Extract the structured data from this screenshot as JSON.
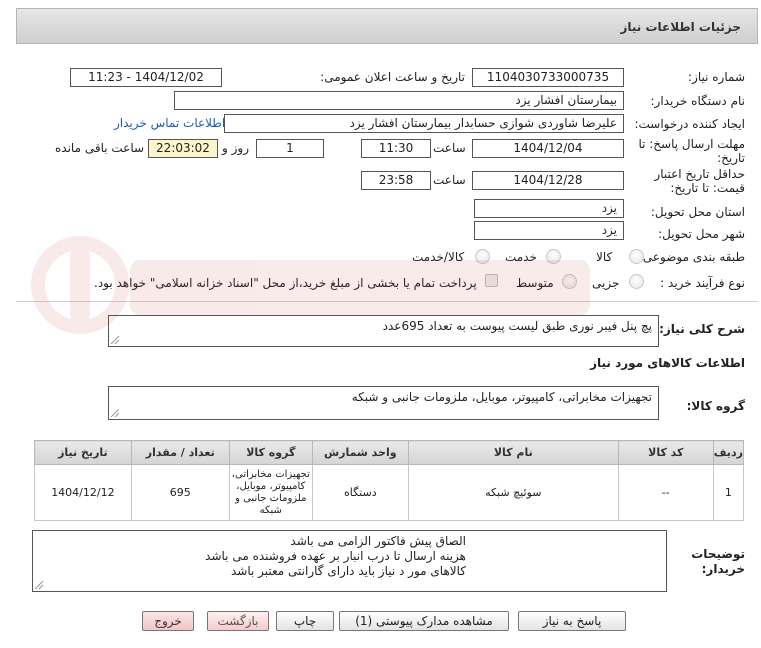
{
  "header": {
    "title": "جزئیات اطلاعات نیاز"
  },
  "need_number": {
    "label": "شماره نیاز:",
    "value": "1104030733000735"
  },
  "announce_datetime": {
    "label": "تاریخ و ساعت اعلان عمومی:",
    "value": "1404/12/02 - 11:23"
  },
  "buyer_org": {
    "label": "نام دستگاه خریدار:",
    "value": "بیمارستان افشار یزد"
  },
  "requester": {
    "label": "ایجاد کننده درخواست:",
    "value": "علیرضا شاوردی شوازی حسابدار بیمارستان افشار یزد",
    "contact_link": "اطلاعات تماس خریدار"
  },
  "response_deadline": {
    "label_line1": "مهلت ارسال پاسخ: تا",
    "label_line2": "تاریخ:",
    "date": "1404/12/04",
    "time_label": "ساعت",
    "time": "11:30",
    "days": "1",
    "days_label": "روز و",
    "remaining": "22:03:02",
    "remaining_label": "ساعت باقی مانده"
  },
  "price_validity": {
    "label_line1": "حداقل تاریخ اعتبار",
    "label_line2": "قیمت: تا تاریخ:",
    "date": "1404/12/28",
    "time_label": "ساعت",
    "time": "23:58"
  },
  "delivery_province": {
    "label": "استان محل تحویل:",
    "value": "یزد"
  },
  "delivery_city": {
    "label": "شهر محل تحویل:",
    "value": "یزد"
  },
  "category": {
    "label": "طبقه بندی موضوعی:",
    "options": [
      "کالا",
      "خدمت",
      "کالا/خدمت"
    ]
  },
  "purchase_process": {
    "label": "نوع فرآیند خرید :",
    "options": [
      "جزیی",
      "متوسط"
    ],
    "payment_note": "پرداخت تمام یا بخشی از مبلغ خرید،از محل \"اسناد خزانه اسلامی\" خواهد بود."
  },
  "general_description": {
    "label": "شرح کلی نیاز:",
    "value": "پچ پنل فیبر نوری  طبق لیست پیوست به تعداد 695عدد"
  },
  "goods_info_title": "اطلاعات کالاهای مورد نیاز",
  "goods_group": {
    "label": "گروه کالا:",
    "value": "تجهیزات مخابراتی، کامپیوتر، موبایل، ملزومات جانبی و شبکه"
  },
  "table": {
    "headers": [
      "ردیف",
      "کد کالا",
      "نام کالا",
      "واحد شمارش",
      "گروه کالا",
      "تعداد / مقدار",
      "تاریخ نیاز"
    ],
    "rows": [
      [
        "1",
        "--",
        "سوئیچ شبکه",
        "دستگاه",
        "تجهیزات مخابراتی، کامپیوتر، موبایل، ملزومات جانبی و شبکه",
        "695",
        "1404/12/12"
      ]
    ]
  },
  "buyer_notes": {
    "label_line1": "توضیحات",
    "label_line2": "خریدار:",
    "lines": [
      "الصاق پیش فاکتور الزامی می باشد",
      "هزینه ارسال تا درب انبار بر عهده فروشنده می باشد",
      "کالاهای مور د نیاز باید دارای گارانتی معتبر باشد"
    ]
  },
  "buttons": {
    "reply": "پاسخ به نیاز",
    "view_docs": "مشاهده مدارک پیوستی (1)",
    "print": "چاپ",
    "back": "بازگشت",
    "exit": "خروج"
  },
  "colors": {
    "header_bg": "#d6d6d6",
    "link": "#1a5fb4",
    "remaining_bg": "#fdf5cc",
    "exit_bg": "#f2c6c6"
  }
}
